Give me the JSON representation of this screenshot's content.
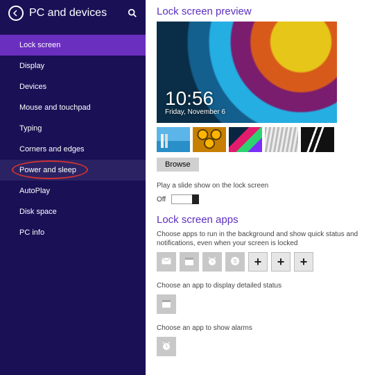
{
  "sidebar": {
    "title": "PC and devices",
    "items": [
      {
        "label": "Lock screen",
        "key": "lock-screen"
      },
      {
        "label": "Display",
        "key": "display"
      },
      {
        "label": "Devices",
        "key": "devices"
      },
      {
        "label": "Mouse and touchpad",
        "key": "mouse-touchpad"
      },
      {
        "label": "Typing",
        "key": "typing"
      },
      {
        "label": "Corners and edges",
        "key": "corners-edges"
      },
      {
        "label": "Power and sleep",
        "key": "power-sleep"
      },
      {
        "label": "AutoPlay",
        "key": "autoplay"
      },
      {
        "label": "Disk space",
        "key": "disk-space"
      },
      {
        "label": "PC info",
        "key": "pc-info"
      }
    ],
    "active_index": 0,
    "circled_index": 6
  },
  "lockscreen": {
    "section_title": "Lock screen preview",
    "clock_time": "10:56",
    "clock_date": "Friday, November 6",
    "browse_label": "Browse",
    "slideshow_desc": "Play a slide show on the lock screen",
    "slideshow_state": "Off"
  },
  "apps": {
    "section_title": "Lock screen apps",
    "quick_desc": "Choose apps to run in the background and show quick status and notifications, even when your screen is locked",
    "quick_icons": [
      "mail-icon",
      "calendar-icon",
      "alarm-icon",
      "skype-icon"
    ],
    "quick_empty_slots": 3,
    "detailed_desc": "Choose an app to display detailed status",
    "detailed_icon": "calendar-icon",
    "alarm_desc": "Choose an app to show alarms",
    "alarm_icon": "alarm-icon"
  }
}
